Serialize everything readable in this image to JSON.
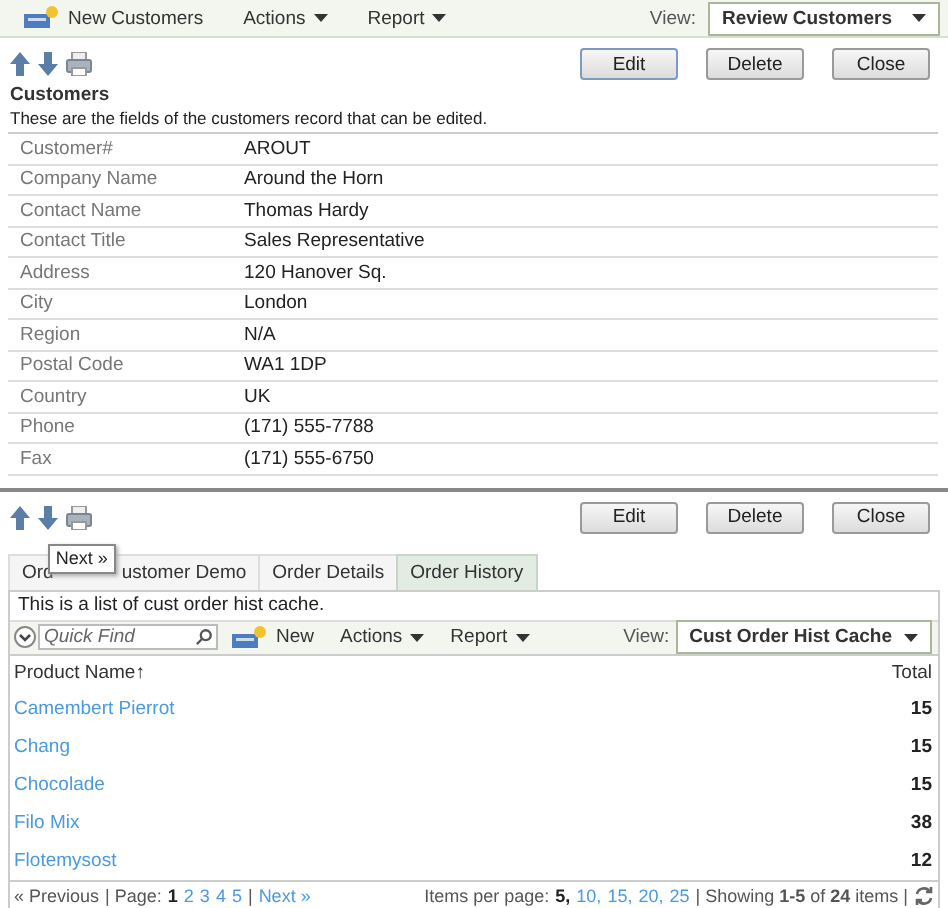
{
  "toolbar": {
    "items": [
      {
        "kind": "new",
        "label": "New Customers"
      },
      {
        "kind": "menu",
        "label": "Actions"
      },
      {
        "kind": "menu",
        "label": "Report"
      }
    ],
    "view_label": "View:",
    "view": "Review Customers"
  },
  "form_buttons": [
    "Edit",
    "Delete",
    "Close"
  ],
  "title": "Customers",
  "description": "These are the fields of the customers record that can be edited.",
  "fields": [
    {
      "label": "Customer#",
      "value": "AROUT"
    },
    {
      "label": "Company Name",
      "value": "Around the Horn"
    },
    {
      "label": "Contact Name",
      "value": "Thomas Hardy"
    },
    {
      "label": "Contact Title",
      "value": "Sales Representative"
    },
    {
      "label": "Address",
      "value": "120 Hanover Sq."
    },
    {
      "label": "City",
      "value": "London"
    },
    {
      "label": "Region",
      "value": "N/A"
    },
    {
      "label": "Postal Code",
      "value": "WA1 1DP"
    },
    {
      "label": "Country",
      "value": "UK"
    },
    {
      "label": "Phone",
      "value": "(171) 555-7788"
    },
    {
      "label": "Fax",
      "value": "(171) 555-6750"
    }
  ],
  "bottom_buttons": [
    "Edit",
    "Delete",
    "Close"
  ],
  "tooltip": "Next »",
  "tabs": [
    {
      "label": "Ord",
      "selected": false
    },
    {
      "label": "ustomer Demo",
      "selected": false
    },
    {
      "label": "Order Details",
      "selected": false
    },
    {
      "label": "Order History",
      "selected": true
    }
  ],
  "grid": {
    "description": "This is a list of cust order hist cache.",
    "quick_find": {
      "placeholder": "Quick Find"
    },
    "toolbar": [
      {
        "kind": "new",
        "label": "New"
      },
      {
        "kind": "menu",
        "label": "Actions"
      },
      {
        "kind": "menu",
        "label": "Report"
      }
    ],
    "view_label": "View:",
    "view": "Cust Order Hist Cache",
    "columns": [
      "Product Name↑",
      "Total"
    ],
    "rows": [
      {
        "product": "Camembert Pierrot",
        "total": "15"
      },
      {
        "product": "Chang",
        "total": "15"
      },
      {
        "product": "Chocolade",
        "total": "15"
      },
      {
        "product": "Filo Mix",
        "total": "38"
      },
      {
        "product": "Flotemysost",
        "total": "12"
      }
    ],
    "pager": {
      "previous": "« Previous",
      "page_label": "| Page:",
      "pages": [
        {
          "label": "1",
          "selected": true
        },
        {
          "label": "2",
          "selected": false
        },
        {
          "label": "3",
          "selected": false
        },
        {
          "label": "4",
          "selected": false
        },
        {
          "label": "5",
          "selected": false
        }
      ],
      "separator": "|",
      "next": "Next »",
      "per_page_label": "Items per page:",
      "per_page": [
        {
          "label": "5,",
          "selected": true
        },
        {
          "label": "10,",
          "selected": false
        },
        {
          "label": "15,",
          "selected": false
        },
        {
          "label": "20,",
          "selected": false
        },
        {
          "label": "25",
          "selected": false
        }
      ],
      "showing": "| Showing **1-5** of **24** items |"
    }
  }
}
